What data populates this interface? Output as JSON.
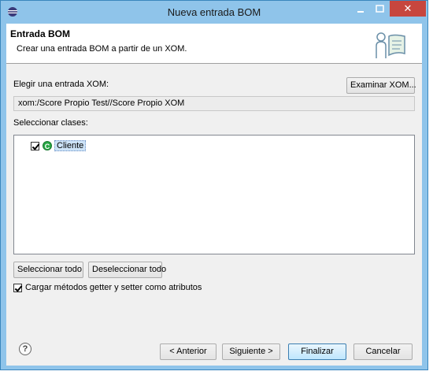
{
  "window": {
    "title": "Nueva entrada BOM",
    "controls": {
      "minimize": "–",
      "maximize": "□",
      "close": "✕"
    }
  },
  "header": {
    "title": "Entrada BOM",
    "description": "Crear una entrada BOM a partir de un XOM.",
    "icon": "wizard-banner-icon"
  },
  "xom": {
    "label": "Elegir una entrada XOM:",
    "browse_label": "Examinar XOM...",
    "value": "xom:/Score Propio Test//Score Propio XOM"
  },
  "classes": {
    "label": "Seleccionar clases:",
    "items": [
      {
        "label": "Cliente",
        "checked": true,
        "icon": "class-icon",
        "icon_glyph": "C"
      }
    ],
    "select_all_label": "Seleccionar todo",
    "deselect_all_label": "Deseleccionar todo"
  },
  "options": {
    "getter_setter_label": "Cargar métodos getter y setter como atributos",
    "getter_setter_checked": true
  },
  "footer": {
    "help_glyph": "?",
    "back_label": "< Anterior",
    "next_label": "Siguiente >",
    "finish_label": "Finalizar",
    "cancel_label": "Cancelar"
  },
  "colors": {
    "titlebar": "#8fc4ea",
    "close_button": "#c7463e",
    "dialog_background": "#f0f0f0",
    "class_icon": "#28a745"
  }
}
